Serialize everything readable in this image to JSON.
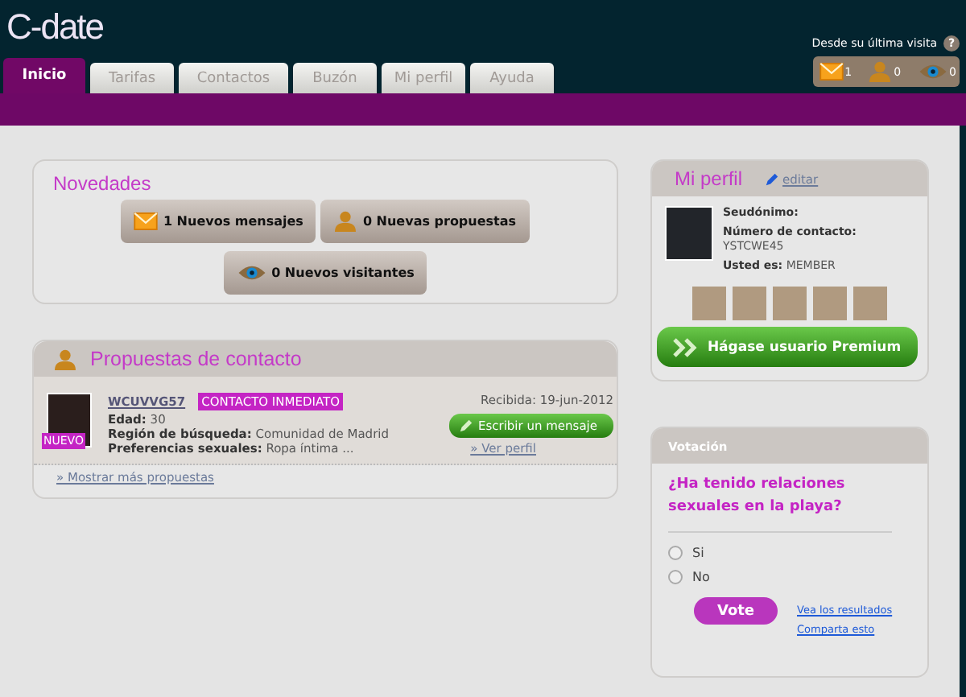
{
  "logo": "C-date",
  "last_visit": {
    "label": "Desde su última visita",
    "help": "?",
    "counters": [
      {
        "kind": "mail",
        "count": "1"
      },
      {
        "kind": "person",
        "count": "0"
      },
      {
        "kind": "eye",
        "count": "0"
      }
    ]
  },
  "tabs": [
    {
      "label": "Inicio",
      "selected": true
    },
    {
      "label": "Tarifas",
      "selected": false
    },
    {
      "label": "Contactos",
      "selected": false
    },
    {
      "label": "Buzón",
      "selected": false
    },
    {
      "label": "Mi perfil",
      "selected": false
    },
    {
      "label": "Ayuda",
      "selected": false
    }
  ],
  "novedades": {
    "title": "Novedades",
    "buttons": [
      {
        "kind": "mail",
        "label": "1 Nuevos mensajes"
      },
      {
        "kind": "person",
        "label": "0 Nuevas propuestas"
      },
      {
        "kind": "eye",
        "label": "0 Nuevos visitantes"
      }
    ]
  },
  "proposals": {
    "title": "Propuestas de contacto",
    "items": [
      {
        "badge": "NUEVO",
        "name": "WCUVVG57",
        "tag": "CONTACTO INMEDIATO",
        "fields": [
          "**Edad:** 30",
          "**Región de búsqueda:** Comunidad de Madrid",
          "**Preferencias sexuales:** Ropa íntima ..."
        ],
        "received": "Recibida: 19-jun-2012",
        "write_button": "Escribir un mensaje",
        "profile_link": "» Ver perfil"
      }
    ],
    "more_link": "» Mostrar más propuestas"
  },
  "profile": {
    "title": "Mi perfil",
    "edit_link": "editar",
    "fields": [
      "**Seudónimo:**",
      "**Número de contacto:**",
      "YSTCWE45",
      "**Usted es:** MEMBER"
    ],
    "premium_button": "Hágase usuario Premium"
  },
  "poll": {
    "title": "Votación",
    "question": "¿Ha tenido relaciones sexuales en la playa?",
    "options": [
      {
        "label": "Si",
        "selected": false
      },
      {
        "label": "No",
        "selected": false
      }
    ],
    "vote_button": "Vote",
    "links": [
      "Vea los resultados",
      "Comparta esto"
    ]
  }
}
